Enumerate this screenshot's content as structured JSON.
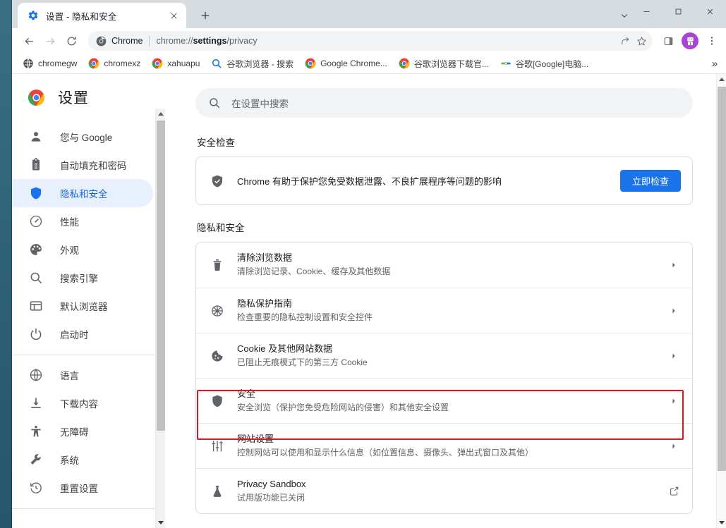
{
  "window": {
    "controls": {
      "minimize": "—",
      "maximize": "□",
      "close": "✕"
    }
  },
  "tabstrip": {
    "tab_title": "设置 - 隐私和安全",
    "tab_favicon": "settings-gear-icon",
    "close_label": "✕",
    "new_tab_label": "+",
    "tab_search_icon": "chevron-down-icon"
  },
  "toolbar": {
    "back_icon": "arrow-left-icon",
    "forward_icon": "arrow-right-icon",
    "reload_icon": "reload-icon",
    "omnibox": {
      "chip_icon": "chrome-logo-icon",
      "chip_label": "Chrome",
      "url_prefix": "chrome://",
      "url_bold": "settings",
      "url_suffix": "/privacy",
      "share_icon": "share-icon",
      "bookmark_icon": "star-icon"
    },
    "side_panel_icon": "side-panel-icon",
    "avatar_icon": "profile-avatar",
    "avatar_color": "#a945d3",
    "menu_icon": "three-dot-menu-icon"
  },
  "bookmarks": {
    "items": [
      {
        "label": "chromegw",
        "icon": "globe-icon"
      },
      {
        "label": "chromexz",
        "icon": "chrome-logo-icon"
      },
      {
        "label": "xahuapu",
        "icon": "chrome-logo-icon"
      },
      {
        "label": "谷歌浏览器 - 搜索",
        "icon": "search-icon"
      },
      {
        "label": "Google Chrome...",
        "icon": "chrome-logo-icon"
      },
      {
        "label": "谷歌浏览器下载官...",
        "icon": "chrome-logo-icon"
      },
      {
        "label": "谷歌[Google]电脑...",
        "icon": "link-icon"
      }
    ],
    "overflow_label": "»"
  },
  "sidebar": {
    "brand_title": "设置",
    "brand_logo": "chrome-logo-icon",
    "items": [
      {
        "label": "您与 Google",
        "icon": "person-icon",
        "active": false
      },
      {
        "label": "自动填充和密码",
        "icon": "clipboard-icon",
        "active": false
      },
      {
        "label": "隐私和安全",
        "icon": "shield-icon",
        "active": true
      },
      {
        "label": "性能",
        "icon": "speedometer-icon",
        "active": false
      },
      {
        "label": "外观",
        "icon": "palette-icon",
        "active": false
      },
      {
        "label": "搜索引擎",
        "icon": "search-icon",
        "active": false
      },
      {
        "label": "默认浏览器",
        "icon": "browser-window-icon",
        "active": false
      },
      {
        "label": "启动时",
        "icon": "power-icon",
        "active": false
      }
    ],
    "items_group2": [
      {
        "label": "语言",
        "icon": "globe-icon"
      },
      {
        "label": "下载内容",
        "icon": "download-icon"
      },
      {
        "label": "无障碍",
        "icon": "accessibility-icon"
      },
      {
        "label": "系统",
        "icon": "wrench-icon"
      },
      {
        "label": "重置设置",
        "icon": "history-restore-icon"
      }
    ]
  },
  "search": {
    "placeholder": "在设置中搜索",
    "icon": "search-icon"
  },
  "main": {
    "safety_check": {
      "section_title": "安全检查",
      "icon": "shield-check-icon",
      "description": "Chrome 有助于保护您免受数据泄露、不良扩展程序等问题的影响",
      "button_label": "立即检查",
      "button_color": "#1a73e8"
    },
    "privacy": {
      "section_title": "隐私和安全",
      "rows": [
        {
          "title": "清除浏览数据",
          "subtitle": "清除浏览记录、Cookie、缓存及其他数据",
          "icon": "trash-icon",
          "end_icon": "chevron-right-icon"
        },
        {
          "title": "隐私保护指南",
          "subtitle": "检查重要的隐私控制设置和安全控件",
          "icon": "privacy-guide-icon",
          "end_icon": "chevron-right-icon"
        },
        {
          "title": "Cookie 及其他网站数据",
          "subtitle": "已阻止无痕模式下的第三方 Cookie",
          "icon": "cookie-icon",
          "end_icon": "chevron-right-icon"
        },
        {
          "title": "安全",
          "subtitle": "安全浏览（保护您免受危险网站的侵害）和其他安全设置",
          "icon": "shield-icon",
          "end_icon": "chevron-right-icon",
          "highlighted": true
        },
        {
          "title": "网站设置",
          "subtitle": "控制网站可以使用和显示什么信息（如位置信息、摄像头、弹出式窗口及其他）",
          "icon": "tune-icon",
          "end_icon": "chevron-right-icon"
        },
        {
          "title": "Privacy Sandbox",
          "subtitle": "试用版功能已关闭",
          "icon": "flask-icon",
          "end_icon": "external-link-icon"
        }
      ]
    },
    "annotation_color": "#e81123"
  }
}
